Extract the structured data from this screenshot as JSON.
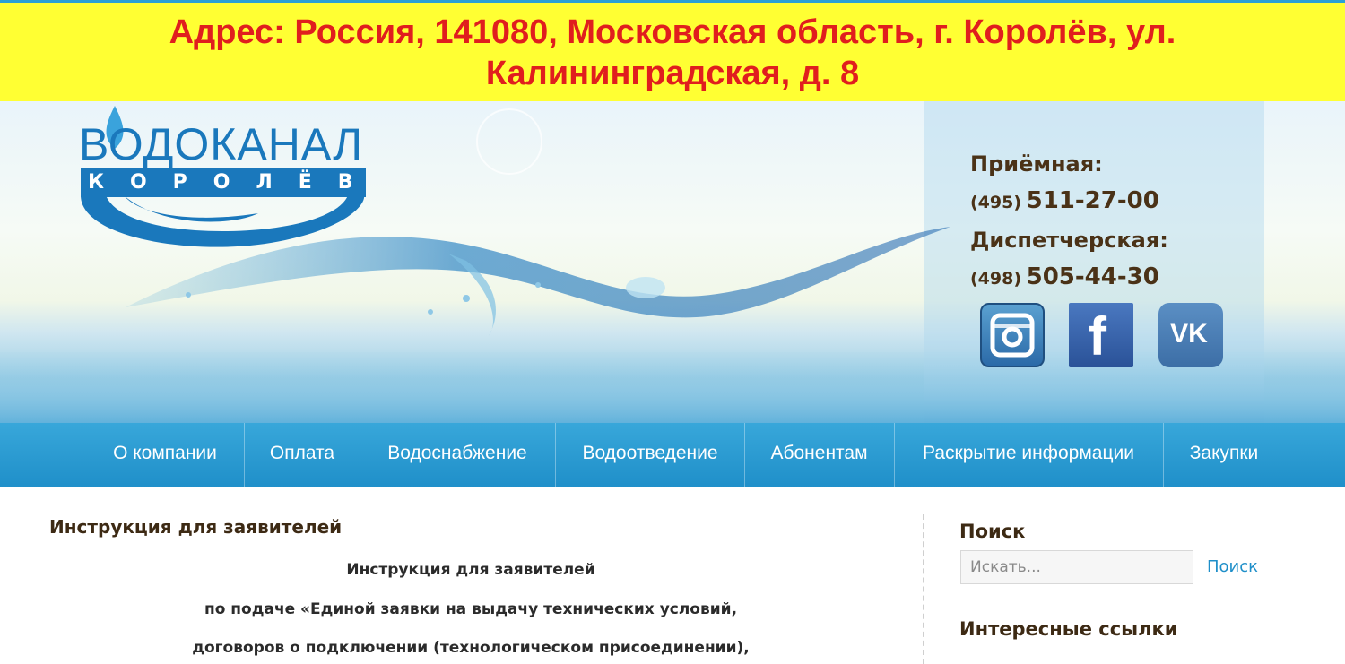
{
  "banner": {
    "line1": "Адрес: Россия, 141080, Московская область, г. Королёв, ул.",
    "line2": "Калининградская, д. 8"
  },
  "logo": {
    "title": "ВОДОКАНАЛ",
    "subtitle": "КОРОЛЁВ"
  },
  "contacts": {
    "reception_label": "Приёмная:",
    "reception_code": "(495)",
    "reception_number": "511-27-00",
    "dispatch_label": "Диспетчерская:",
    "dispatch_code": "(498)",
    "dispatch_number": "505-44-30"
  },
  "social": {
    "instagram_icon": "instagram-icon",
    "facebook_icon": "facebook-icon",
    "vk_icon": "vk-icon",
    "facebook_glyph": "f",
    "vk_glyph": "VK"
  },
  "nav": {
    "items": [
      "О компании",
      "Оплата",
      "Водоснабжение",
      "Водоотведение",
      "Абонентам",
      "Раскрытие информации",
      "Закупки"
    ]
  },
  "content": {
    "title": "Инструкция для заявителей",
    "doc_lines": [
      "Инструкция для заявителей",
      "по подаче «Единой заявки на выдачу технических условий,",
      "договоров о подключении (технологическом присоединении),"
    ]
  },
  "sidebar": {
    "search_heading": "Поиск",
    "search_placeholder": "Искать...",
    "search_button": "Поиск",
    "links_heading": "Интересные ссылки"
  },
  "colors": {
    "banner_bg": "#ffff33",
    "banner_text": "#e01e1e",
    "nav_bg": "#1f8fc9",
    "brand_blue": "#1a78bc",
    "heading_brown": "#3d2a14"
  }
}
